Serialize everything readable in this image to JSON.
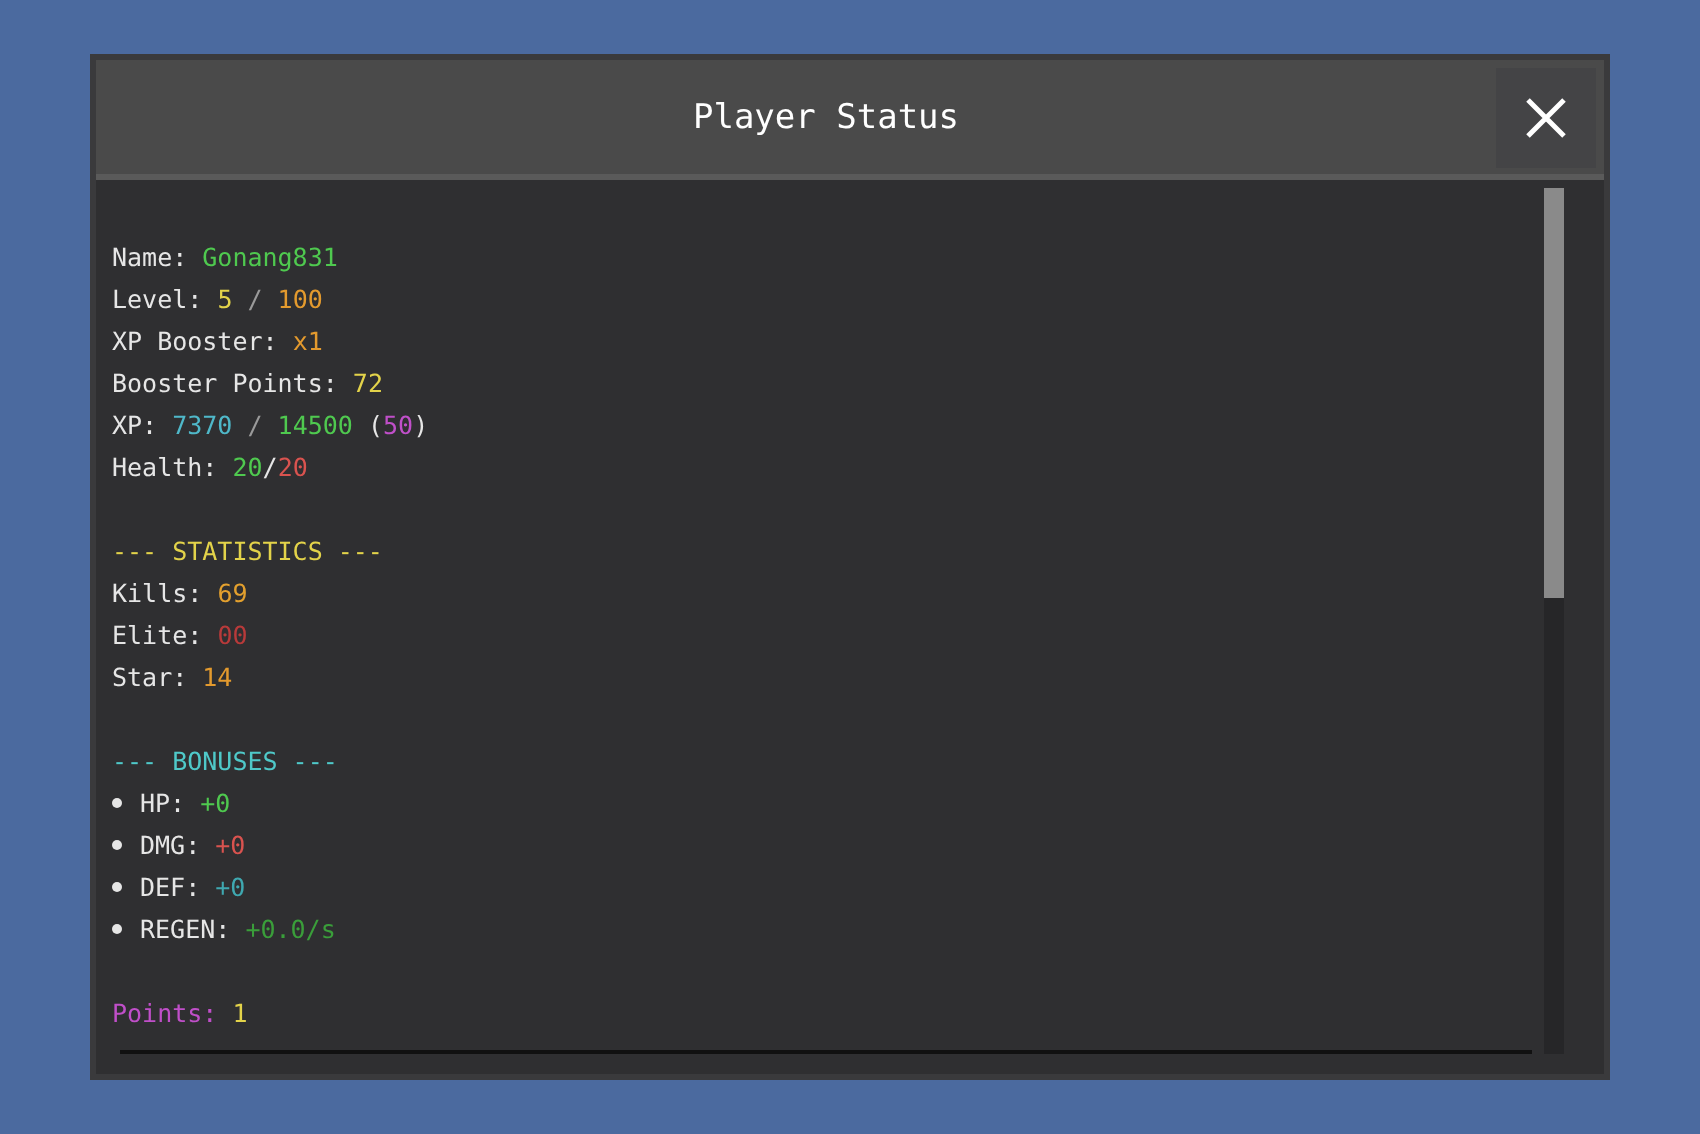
{
  "window": {
    "title": "Player Status"
  },
  "lines": [
    {
      "kind": "text",
      "segments": [
        {
          "text": "Name: ",
          "color": "#e6e6e6"
        },
        {
          "text": "Gonang831",
          "color": "#4fc94f"
        }
      ]
    },
    {
      "kind": "text",
      "segments": [
        {
          "text": "Level: ",
          "color": "#e6e6e6"
        },
        {
          "text": "5",
          "color": "#e3d34a"
        },
        {
          "text": " / ",
          "color": "#9a9a9a"
        },
        {
          "text": "100",
          "color": "#e39a2e"
        }
      ]
    },
    {
      "kind": "text",
      "segments": [
        {
          "text": "XP Booster: ",
          "color": "#e6e6e6"
        },
        {
          "text": "x1",
          "color": "#e39a2e"
        }
      ]
    },
    {
      "kind": "text",
      "segments": [
        {
          "text": "Booster Points: ",
          "color": "#e6e6e6"
        },
        {
          "text": "72",
          "color": "#e3d34a"
        }
      ]
    },
    {
      "kind": "text",
      "segments": [
        {
          "text": "XP: ",
          "color": "#e6e6e6"
        },
        {
          "text": "7370",
          "color": "#4fb8c9"
        },
        {
          "text": " / ",
          "color": "#9a9a9a"
        },
        {
          "text": "14500",
          "color": "#4fc94f"
        },
        {
          "text": " (",
          "color": "#e6e6e6"
        },
        {
          "text": "50",
          "color": "#c04fc9"
        },
        {
          "text": ")",
          "color": "#e6e6e6"
        }
      ]
    },
    {
      "kind": "text",
      "segments": [
        {
          "text": "Health: ",
          "color": "#e6e6e6"
        },
        {
          "text": "20",
          "color": "#4fc94f"
        },
        {
          "text": "/",
          "color": "#e6e6e6"
        },
        {
          "text": "20",
          "color": "#d9534f"
        }
      ]
    },
    {
      "kind": "blank"
    },
    {
      "kind": "text",
      "segments": [
        {
          "text": "--- STATISTICS ---",
          "color": "#e3d34a"
        }
      ]
    },
    {
      "kind": "text",
      "segments": [
        {
          "text": "Kills: ",
          "color": "#e6e6e6"
        },
        {
          "text": "69",
          "color": "#e3a02e"
        }
      ]
    },
    {
      "kind": "text",
      "segments": [
        {
          "text": "Elite: ",
          "color": "#e6e6e6"
        },
        {
          "text": "00",
          "color": "#b83a3a"
        }
      ]
    },
    {
      "kind": "text",
      "segments": [
        {
          "text": "Star: ",
          "color": "#e6e6e6"
        },
        {
          "text": "14",
          "color": "#e39a2e"
        }
      ]
    },
    {
      "kind": "blank"
    },
    {
      "kind": "text",
      "segments": [
        {
          "text": "--- BONUSES ---",
          "color": "#4fc9c9"
        }
      ]
    },
    {
      "kind": "bullet",
      "segments": [
        {
          "text": "HP: ",
          "color": "#e6e6e6"
        },
        {
          "text": "+0",
          "color": "#4fc94f"
        }
      ]
    },
    {
      "kind": "bullet",
      "segments": [
        {
          "text": "DMG: ",
          "color": "#e6e6e6"
        },
        {
          "text": "+0",
          "color": "#d9534f"
        }
      ]
    },
    {
      "kind": "bullet",
      "segments": [
        {
          "text": "DEF: ",
          "color": "#e6e6e6"
        },
        {
          "text": "+0",
          "color": "#3fa8b0"
        }
      ]
    },
    {
      "kind": "bullet",
      "segments": [
        {
          "text": "REGEN: ",
          "color": "#e6e6e6"
        },
        {
          "text": "+0.0/s",
          "color": "#3a9e3a"
        }
      ]
    },
    {
      "kind": "blank"
    },
    {
      "kind": "text",
      "segments": [
        {
          "text": "Points: ",
          "color": "#c04fc9"
        },
        {
          "text": "1",
          "color": "#e3d34a"
        }
      ]
    }
  ]
}
